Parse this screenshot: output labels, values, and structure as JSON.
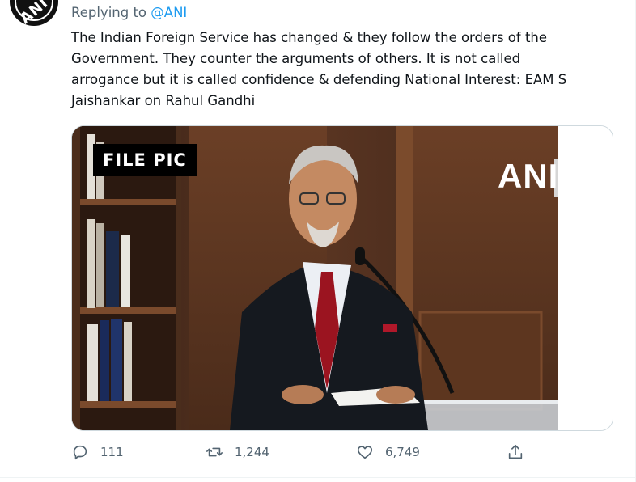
{
  "reply": {
    "prefix": "Replying to",
    "handle": "@ANI"
  },
  "avatar": {
    "logo": "ANI"
  },
  "tweet": {
    "lines": [
      "The Indian Foreign Service has changed & they follow the orders of the",
      "Government. They counter the arguments of others. It is not called",
      "arrogance but it is called confidence & defending National Interest: EAM S",
      "Jaishankar on Rahul Gandhi"
    ]
  },
  "media": {
    "file_pic_label": "FILE PIC",
    "watermark": "ANI"
  },
  "actions": {
    "reply": {
      "icon": "comment-icon",
      "count": "111"
    },
    "retweet": {
      "icon": "retweet-icon",
      "count": "1,244"
    },
    "like": {
      "icon": "heart-icon",
      "count": "6,749"
    },
    "share": {
      "icon": "share-icon"
    }
  },
  "colors": {
    "link": "#1d9bf0",
    "secondary": "#536471",
    "text": "#0f1419",
    "border": "#cfd9de"
  }
}
